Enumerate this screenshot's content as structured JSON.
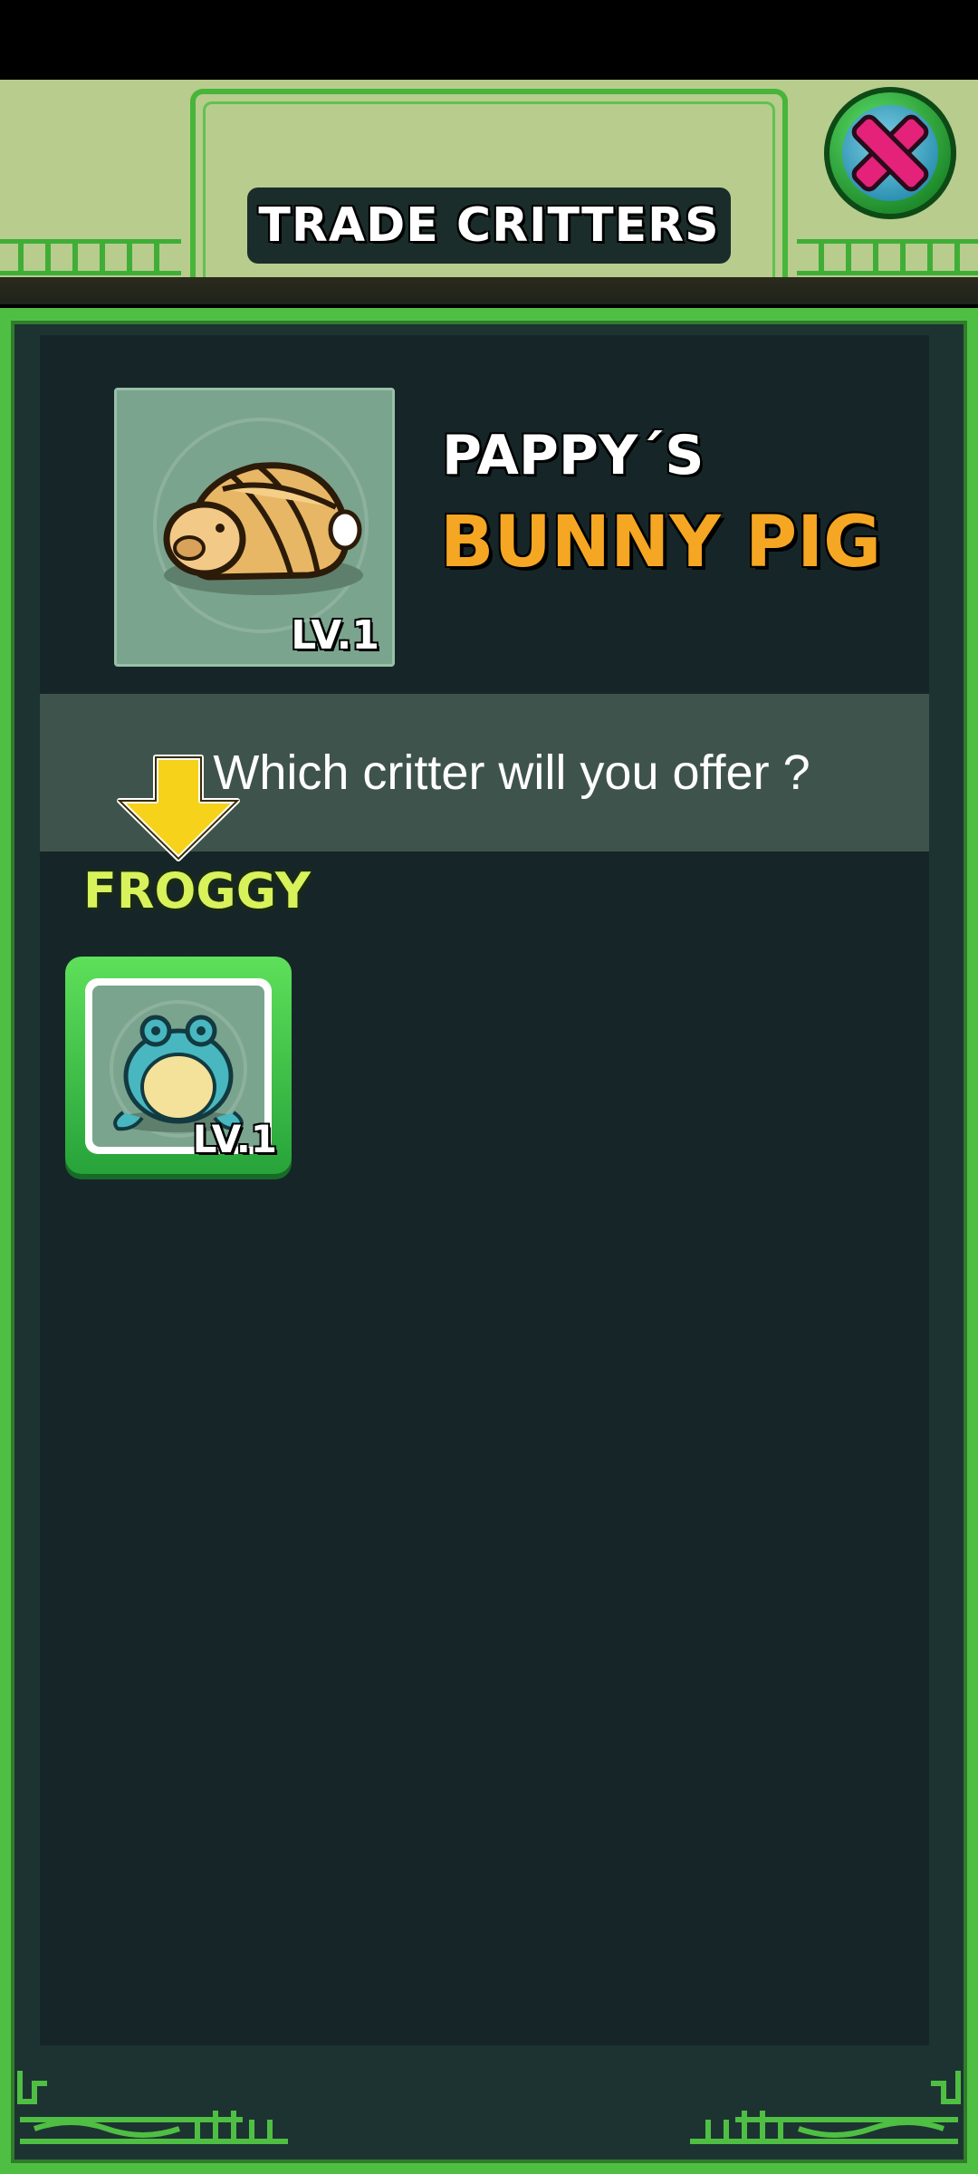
{
  "header": {
    "title": "TRADE CRITTERS"
  },
  "close_button": {
    "icon": "close-x-icon"
  },
  "featured": {
    "owner": "PAPPY´S",
    "critter": "BUNNY PIG",
    "level": "LV.1",
    "image": "bunny-pig-icon"
  },
  "prompt": {
    "text": "Which critter will you offer ?"
  },
  "offer": {
    "name": "FROGGY",
    "level": "LV.1",
    "image": "froggy-icon"
  },
  "colors": {
    "frame_green": "#4fbf43",
    "panel_dark": "#162628",
    "critter_name_orange": "#f5a623",
    "option_name_lime": "#d8f25c",
    "hint_arrow_yellow": "#f6d21b"
  }
}
